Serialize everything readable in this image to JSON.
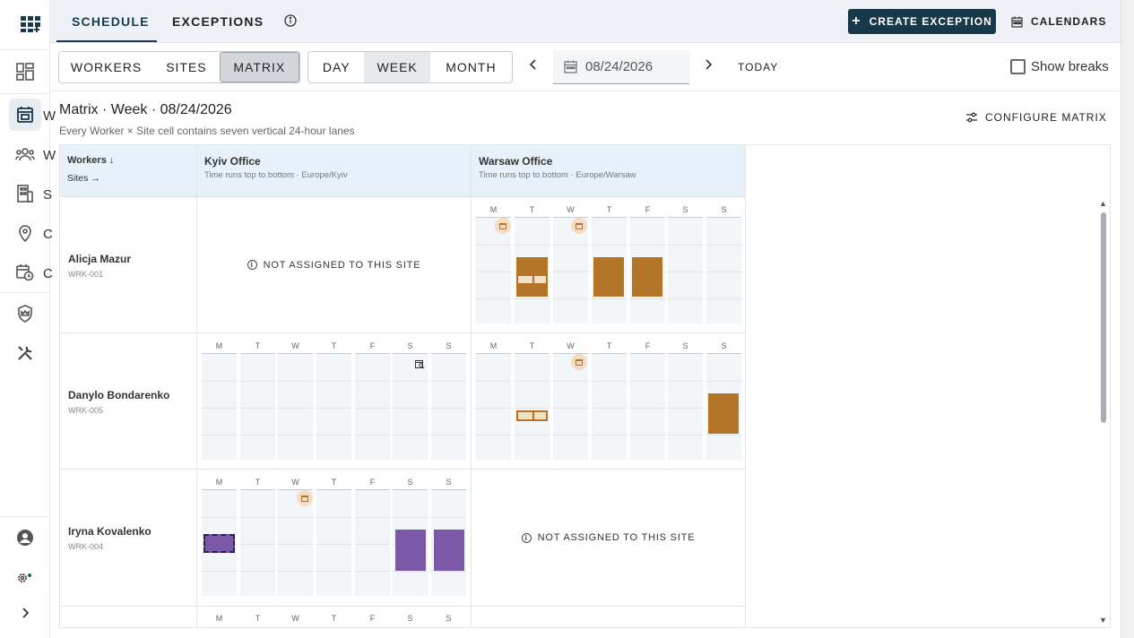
{
  "nav": {
    "rail_clipped_labels": [
      "W",
      "W",
      "S",
      "C",
      "C"
    ]
  },
  "topbar": {
    "tabs": [
      {
        "label": "SCHEDULE",
        "active": true
      },
      {
        "label": "EXCEPTIONS",
        "active": false
      }
    ],
    "create_label": "CREATE EXCEPTION",
    "calendars_label": "CALENDARS"
  },
  "toolbar": {
    "view_modes": [
      "WORKERS",
      "SITES",
      "MATRIX"
    ],
    "selected_view": "MATRIX",
    "ranges": [
      "DAY",
      "WEEK",
      "MONTH"
    ],
    "selected_range": "WEEK",
    "date": "08/24/2026",
    "today_label": "TODAY",
    "show_breaks_label": "Show breaks",
    "show_breaks_checked": false
  },
  "matrix": {
    "title": "Matrix · Week · 08/24/2026",
    "subtitle": "Every Worker × Site cell contains seven vertical 24-hour lanes",
    "configure_label": "CONFIGURE MATRIX",
    "corner_workers": "Workers ↓",
    "corner_sites": "Sites →",
    "sites": [
      {
        "name": "Kyiv Office",
        "sub": "Time runs top to bottom · Europe/Kyiv"
      },
      {
        "name": "Warsaw Office",
        "sub": "Time runs top to bottom · Europe/Warsaw"
      }
    ],
    "day_letters": [
      "M",
      "T",
      "W",
      "T",
      "F",
      "S",
      "S"
    ],
    "not_assigned_label": "NOT ASSIGNED TO THIS SITE",
    "rows": [
      {
        "name": "Alicja Mazur",
        "id": "WRK-001"
      },
      {
        "name": "Danylo Bondarenko",
        "id": "WRK-005"
      },
      {
        "name": "Iryna Kovalenko",
        "id": "WRK-004"
      }
    ]
  },
  "colors": {
    "brand_dark": "#17394a",
    "shift_warsaw": "#b37428",
    "shift_kyiv": "#7b59a8",
    "header_bg": "#e8f1fa"
  }
}
